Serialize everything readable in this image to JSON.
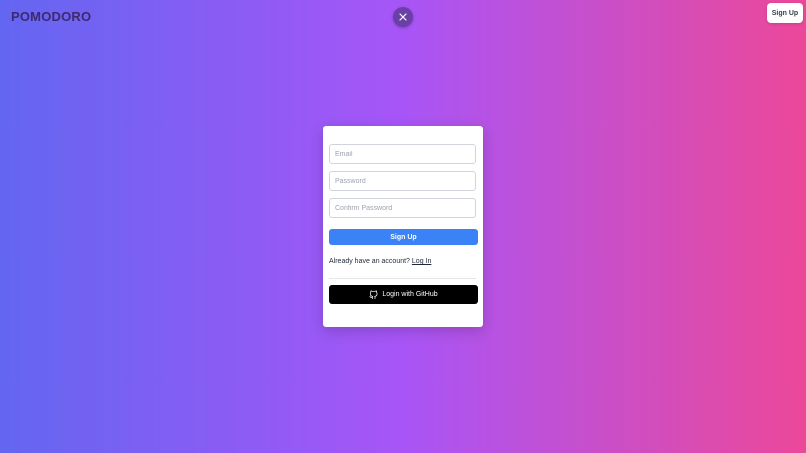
{
  "header": {
    "brand": "POMODORO",
    "signup_label": "Sign Up"
  },
  "icons": {
    "close": "close-icon",
    "github": "github-icon"
  },
  "colors": {
    "gradient_start": "#6366f1",
    "gradient_mid": "#a855f7",
    "gradient_end": "#ec4899",
    "primary_button": "#3b82f6",
    "github_button": "#000000"
  },
  "form": {
    "email_placeholder": "Email",
    "email_value": "",
    "password_placeholder": "Password",
    "password_value": "",
    "confirm_placeholder": "Confirm Password",
    "confirm_value": "",
    "submit_label": "Sign Up",
    "account_prompt": "Already have an account?",
    "login_link": "Log In",
    "github_label": "Login with GitHub"
  }
}
